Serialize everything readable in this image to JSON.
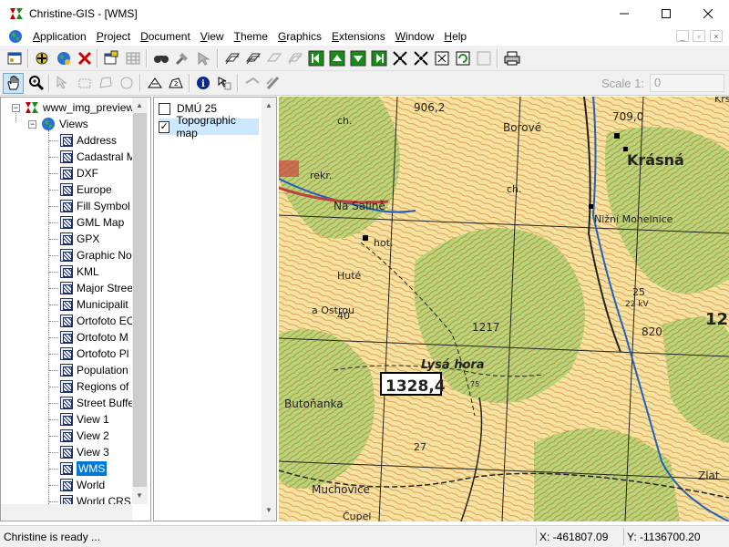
{
  "window": {
    "title": "Christine-GIS - [WMS]",
    "minimize_icon": "minimize-icon",
    "maximize_icon": "maximize-icon",
    "close_icon": "close-icon"
  },
  "menu": {
    "items": [
      {
        "label": "Application",
        "hotkey": "A",
        "rest": "pplication"
      },
      {
        "label": "Project",
        "hotkey": "P",
        "rest": "roject"
      },
      {
        "label": "Document",
        "hotkey": "D",
        "rest": "ocument"
      },
      {
        "label": "View",
        "hotkey": "V",
        "rest": "iew"
      },
      {
        "label": "Theme",
        "hotkey": "T",
        "rest": "heme"
      },
      {
        "label": "Graphics",
        "hotkey": "G",
        "rest": "raphics"
      },
      {
        "label": "Extensions",
        "hotkey": "E",
        "rest": "xtensions"
      },
      {
        "label": "Window",
        "hotkey": "W",
        "rest": "indow"
      },
      {
        "label": "Help",
        "hotkey": "H",
        "rest": "elp"
      }
    ]
  },
  "toolbar": {
    "scale_label": "Scale 1:",
    "scale_value": "0"
  },
  "tree": {
    "root": "www_img_preview",
    "folder": "Views",
    "items": [
      "Address",
      "Cadastral M",
      "DXF",
      "Europe",
      "Fill Symbol",
      "GML Map",
      "GPX",
      "Graphic No",
      "KML",
      "Major Stree",
      "Municipalit",
      "Ortofoto EC",
      "Ortofoto M",
      "Ortofoto Pl",
      "Population",
      "Regions of",
      "Street Buffe",
      "View 1",
      "View 2",
      "View 3",
      "WMS",
      "World",
      "World CRS"
    ],
    "selected": "WMS"
  },
  "layers": [
    {
      "label": "DMÚ 25",
      "checked": false
    },
    {
      "label": "Topographic map",
      "checked": true
    }
  ],
  "map": {
    "labels": [
      "906,2",
      "ch.",
      "Borové",
      "709,0",
      "Kršna",
      "Krásná",
      "rekr.",
      "Na Salině",
      "ch.",
      "Nižní Mohelnice",
      "hot.",
      "Huté",
      "25",
      "12",
      "a Ostrou",
      "40",
      "1217",
      "820",
      "Lysá hora",
      "1328,4",
      "75",
      "Butoňanka",
      "27",
      "Muchovice",
      "Čupel",
      "Zlat",
      "22 kV"
    ],
    "summit_label": "1328,4"
  },
  "status": {
    "text": "Christine is ready ...",
    "x": "X: -461807.09",
    "y": "Y: -1136700.20"
  }
}
